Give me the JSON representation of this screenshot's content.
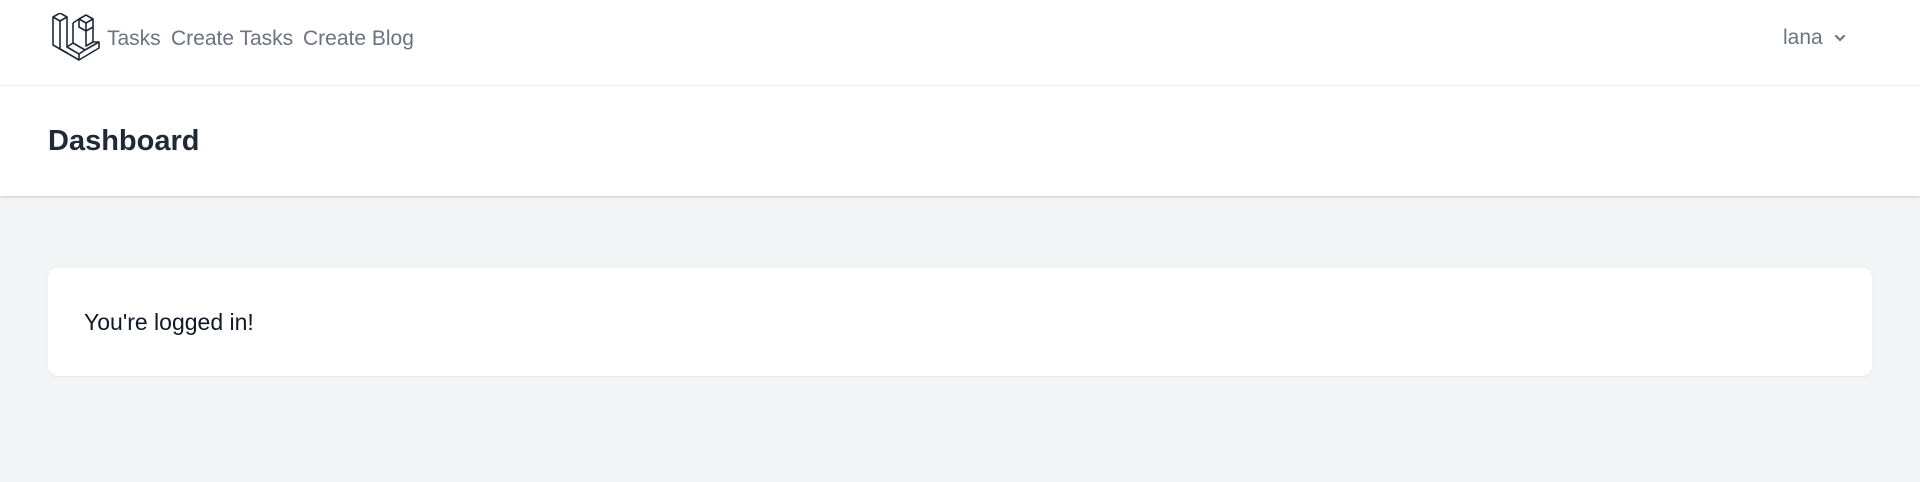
{
  "nav": {
    "logo_icon": "laravel-logo-icon",
    "links": [
      {
        "label": "Tasks"
      },
      {
        "label": "Create Tasks"
      },
      {
        "label": "Create Blog"
      }
    ],
    "user": {
      "name": "lana",
      "dropdown_icon": "chevron-down-icon"
    }
  },
  "header": {
    "title": "Dashboard"
  },
  "main": {
    "message": "You're logged in!"
  },
  "colors": {
    "background": "#f3f4f6",
    "surface": "#ffffff",
    "nav_text": "#6b7280",
    "title_text": "#1f2937"
  }
}
